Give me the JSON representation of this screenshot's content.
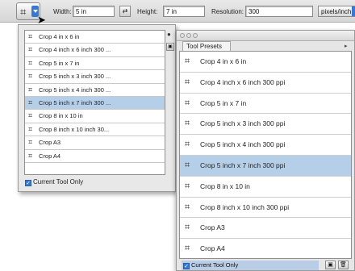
{
  "options_bar": {
    "width_label": "Width:",
    "width_value": "5 in",
    "height_label": "Height:",
    "height_value": "7 in",
    "resolution_label": "Resolution:",
    "resolution_value": "300",
    "units_value": "pixels/inch",
    "swap_icon": "⇄",
    "tool_icon": "crop-icon"
  },
  "dropdown": {
    "items": [
      "Crop 4 in x 6 in",
      "Crop 4 inch x 6 inch 300 ...",
      "Crop 5 in x 7 in",
      "Crop 5 inch x 3 inch 300 ...",
      "Crop 5 inch x 4 inch 300 ...",
      "Crop 5 inch x 7 inch 300 ...",
      "Crop 8 in x 10 in",
      "Crop 8 inch x 10 inch 30...",
      "Crop A3",
      "Crop A4"
    ],
    "selected_index": 5,
    "current_tool_only": "Current Tool Only"
  },
  "palette": {
    "tab_label": "Tool Presets",
    "items": [
      "Crop 4 in x 6 in",
      "Crop 4 inch x 6 inch 300 ppi",
      "Crop 5 in x 7 in",
      "Crop 5 inch x 3 inch 300 ppi",
      "Crop 5 inch x 4 inch 300 ppi",
      "Crop 5 inch x 7 inch 300 ppi",
      "Crop 8 in x 10 in",
      "Crop 8 inch x 10 inch 300 ppi",
      "Crop A3",
      "Crop A4"
    ],
    "selected_index": 5,
    "current_tool_only": "Current Tool Only"
  },
  "colors": {
    "selection": "#b6cfe9",
    "accent": "#3478d8"
  }
}
